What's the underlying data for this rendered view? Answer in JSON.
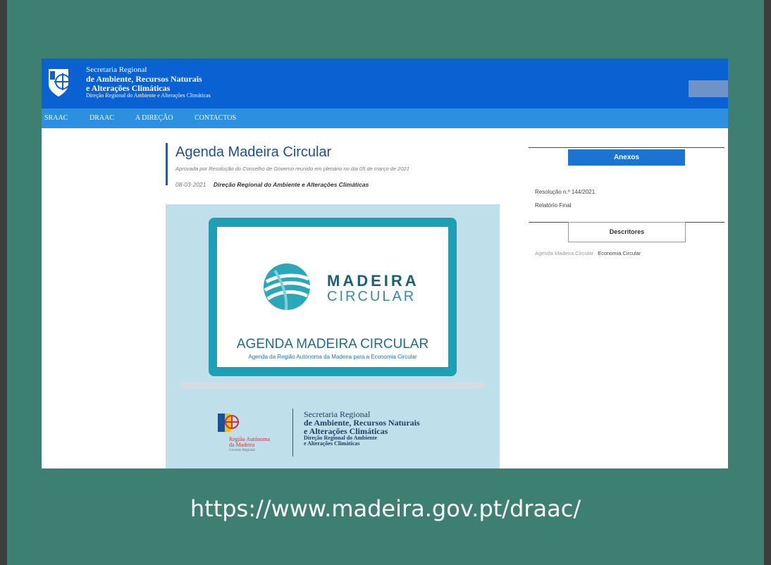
{
  "header": {
    "line1": "Secretaria Regional",
    "line2": "de Ambiente, Recursos Naturais",
    "line3": "e Alterações Climáticas",
    "line4": "Direção Regional do Ambiente e Alterações Climáticas",
    "logo_icon": "region-shield-logo-icon"
  },
  "nav": {
    "items": [
      {
        "label": "SRAAC"
      },
      {
        "label": "DRAAC"
      },
      {
        "label": "A DIREÇÃO"
      },
      {
        "label": "CONTACTOS"
      }
    ]
  },
  "article": {
    "title": "Agenda Madeira Circular",
    "subtitle": "Aprovada por Resolução do Conselho de Governo reunido em plenário no dia 05 de março de 2021",
    "date": "08-03-2021",
    "author": "Direção Regional do Ambiente e Alterações Climáticas"
  },
  "poster": {
    "brand_line1": "MADEIRA",
    "brand_line2": "CIRCULAR",
    "agenda_title": "AGENDA MADEIRA CIRCULAR",
    "agenda_subtitle": "Agenda da Região Autónoma da Madeira para a Economia Circular",
    "region_line1": "Região Autónoma",
    "region_line2": "da Madeira",
    "region_line3": "Governo Regional",
    "sec_line1": "Secretaria Regional",
    "sec_line2": "de Ambiente, Recursos Naturais",
    "sec_line3": "e Alterações Climáticas",
    "sec_line4": "Direção Regional do Ambiente",
    "sec_line5": "e Alterações Climáticas"
  },
  "aside": {
    "anexos_label": "Anexos",
    "docs": [
      {
        "label": "Resolução n.º 144/2021"
      },
      {
        "label": "Relatório Final"
      }
    ],
    "descritores_label": "Descritores",
    "tags": [
      {
        "label": "Agenda Madeira Circular"
      },
      {
        "label": "Economia Circular"
      }
    ]
  },
  "footer": {
    "url": "https://www.madeira.gov.pt/draac/"
  },
  "colors": {
    "slide_bg": "#3d7f70",
    "header_blue": "#0a62d2",
    "nav_blue": "#2d8fe0",
    "teal": "#1f9fb5"
  }
}
